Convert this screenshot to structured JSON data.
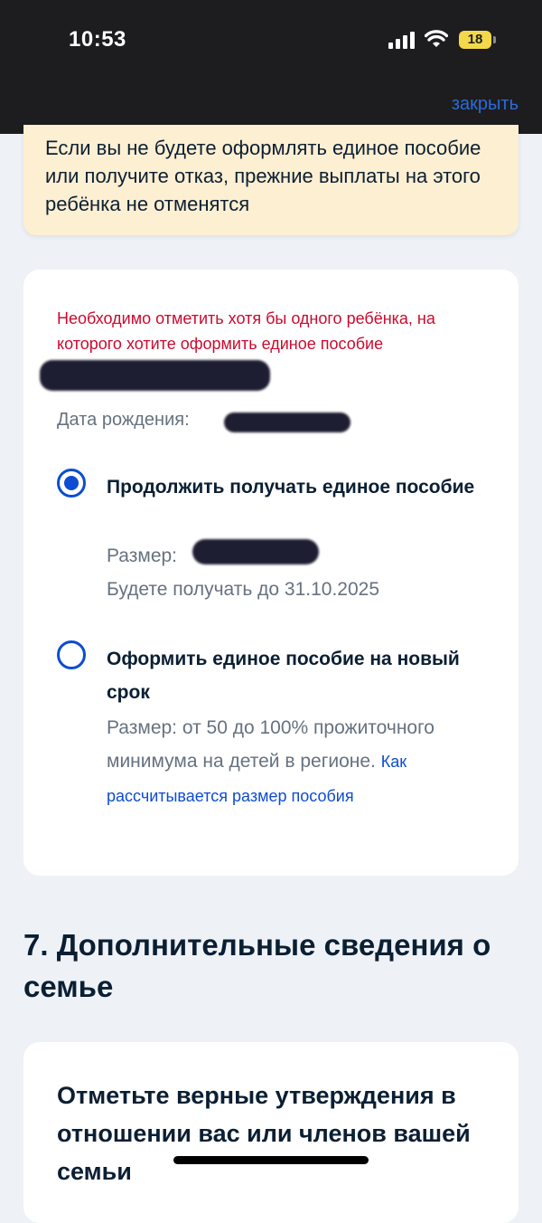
{
  "status_bar": {
    "time": "10:53",
    "battery": "18"
  },
  "header": {
    "close_label": "закрыть"
  },
  "notice": {
    "text": "Если вы не будете оформлять единое пособие или получите отказ, прежние выплаты на этого ребёнка не отменятся"
  },
  "child_card": {
    "error_text": "Необходимо отметить хотя бы одного ребёнка, на которого хотите оформить единое пособие",
    "birth_date_label": "Дата рождения:",
    "options": [
      {
        "title": "Продолжить получать единое пособие",
        "selected": true,
        "size_label": "Размер:",
        "until_text": "Будете получать до 31.10.2025"
      },
      {
        "title": "Оформить единое пособие на новый срок",
        "selected": false,
        "description": "Размер: от 50 до 100% прожиточного минимума на детей в регионе.",
        "link_text": "Как рассчитывается размер пособия"
      }
    ]
  },
  "section": {
    "title": "7. Дополнительные сведения о семье"
  },
  "family_card": {
    "title": "Отметьте верные утверждения в отношении вас или членов вашей семьи"
  }
}
